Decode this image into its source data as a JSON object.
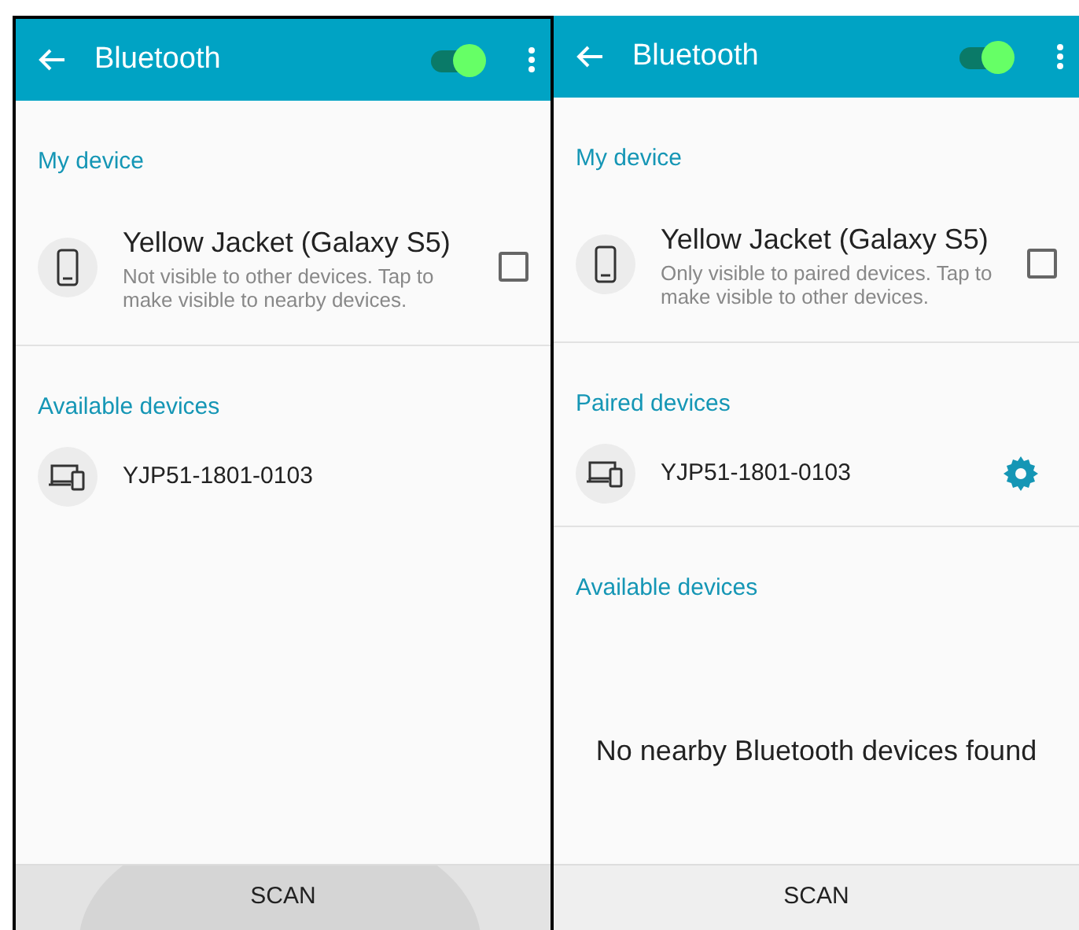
{
  "screens": [
    {
      "title": "Bluetooth",
      "bluetooth_on": true,
      "sections": [
        {
          "header": "My device",
          "items": [
            {
              "kind": "my_device",
              "name": "Yellow Jacket (Galaxy S5)",
              "subtitle": "Not visible to other devices. Tap to make visible to nearby devices.",
              "checked": false
            }
          ]
        },
        {
          "header": "Available devices",
          "items": [
            {
              "kind": "available",
              "name": "YJP51-1801-0103"
            }
          ]
        }
      ],
      "scan_button": {
        "label": "SCAN",
        "pressed": true
      }
    },
    {
      "title": "Bluetooth",
      "bluetooth_on": true,
      "sections": [
        {
          "header": "My device",
          "items": [
            {
              "kind": "my_device",
              "name": "Yellow Jacket (Galaxy S5)",
              "subtitle": "Only visible to paired devices. Tap to make visible to other devices.",
              "checked": false
            }
          ]
        },
        {
          "header": "Paired devices",
          "items": [
            {
              "kind": "paired",
              "name": "YJP51-1801-0103"
            }
          ]
        },
        {
          "header": "Available devices",
          "empty_message": "No nearby Bluetooth devices found"
        }
      ],
      "scan_button": {
        "label": "SCAN",
        "pressed": false
      }
    }
  ]
}
